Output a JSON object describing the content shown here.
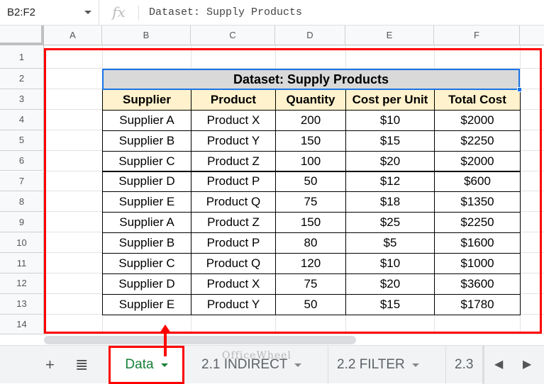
{
  "formula_bar": {
    "name_box": "B2:F2",
    "fx": "fx",
    "formula": "Dataset: Supply Products"
  },
  "columns": [
    "A",
    "B",
    "C",
    "D",
    "E",
    "F"
  ],
  "rows": [
    "1",
    "2",
    "3",
    "4",
    "5",
    "6",
    "7",
    "8",
    "9",
    "10",
    "11",
    "12",
    "13",
    "14"
  ],
  "table": {
    "title": "Dataset: Supply Products",
    "headers": [
      "Supplier",
      "Product",
      "Quantity",
      "Cost per Unit",
      "Total Cost"
    ],
    "data": [
      [
        "Supplier A",
        "Product X",
        "200",
        "$10",
        "$2000"
      ],
      [
        "Supplier B",
        "Product Y",
        "150",
        "$15",
        "$2250"
      ],
      [
        "Supplier C",
        "Product Z",
        "100",
        "$20",
        "$2000"
      ],
      [
        "Supplier D",
        "Product P",
        "50",
        "$12",
        "$600"
      ],
      [
        "Supplier E",
        "Product Q",
        "75",
        "$18",
        "$1350"
      ],
      [
        "Supplier A",
        "Product Z",
        "150",
        "$25",
        "$2250"
      ],
      [
        "Supplier B",
        "Product P",
        "80",
        "$5",
        "$1600"
      ],
      [
        "Supplier C",
        "Product Q",
        "120",
        "$10",
        "$1000"
      ],
      [
        "Supplier D",
        "Product X",
        "75",
        "$20",
        "$3600"
      ],
      [
        "Supplier E",
        "Product Y",
        "50",
        "$15",
        "$1780"
      ]
    ]
  },
  "sheet_tabs": {
    "add": "+",
    "list": "≣",
    "tabs": [
      "Data",
      "2.1 INDIRECT",
      "2.2 FILTER",
      "2.3"
    ],
    "prev": "◀",
    "next": "▶"
  },
  "watermark": "OfficeWheel"
}
